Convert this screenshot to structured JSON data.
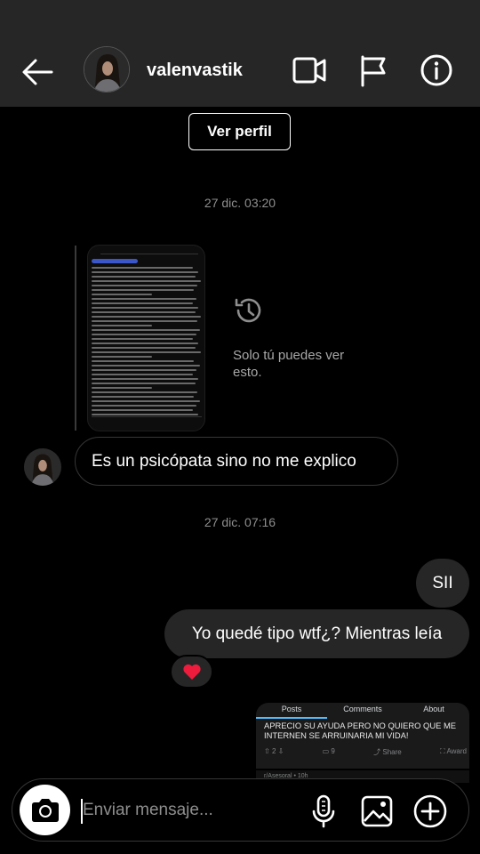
{
  "header": {
    "username": "valenvastik",
    "icons": [
      "back-arrow-icon",
      "video-call-icon",
      "flag-icon",
      "info-icon"
    ]
  },
  "profile_button": "Ver perfil",
  "timestamps": [
    "27 dic. 03:20",
    "27 dic. 07:16"
  ],
  "disappearing_media": {
    "status_text": "Solo tú puedes ver esto.",
    "icon": "history-icon"
  },
  "messages": {
    "incoming": "Es un psicópata sino no me explico",
    "outgoing_1": "SII",
    "outgoing_2": "Yo quedé tipo wtf¿? Mientras leía",
    "reaction": "❤️"
  },
  "shared_post": {
    "tabs": [
      "Posts",
      "Comments",
      "About"
    ],
    "title": "APRECIO SU AYUDA PERO NO QUIERO QUE ME INTERNEN SE ARRUINARIA MI VIDA!",
    "votes": "2",
    "comments": "9",
    "share": "Share",
    "award": "Award",
    "subline": "r/Asesoral • 10h"
  },
  "composer": {
    "placeholder": "Enviar mensaje..."
  },
  "colors": {
    "background": "#000000",
    "header_bg": "#262626",
    "bubble_out": "#262626",
    "muted_text": "#8e8e8e",
    "heart": "#ed1c3c"
  }
}
